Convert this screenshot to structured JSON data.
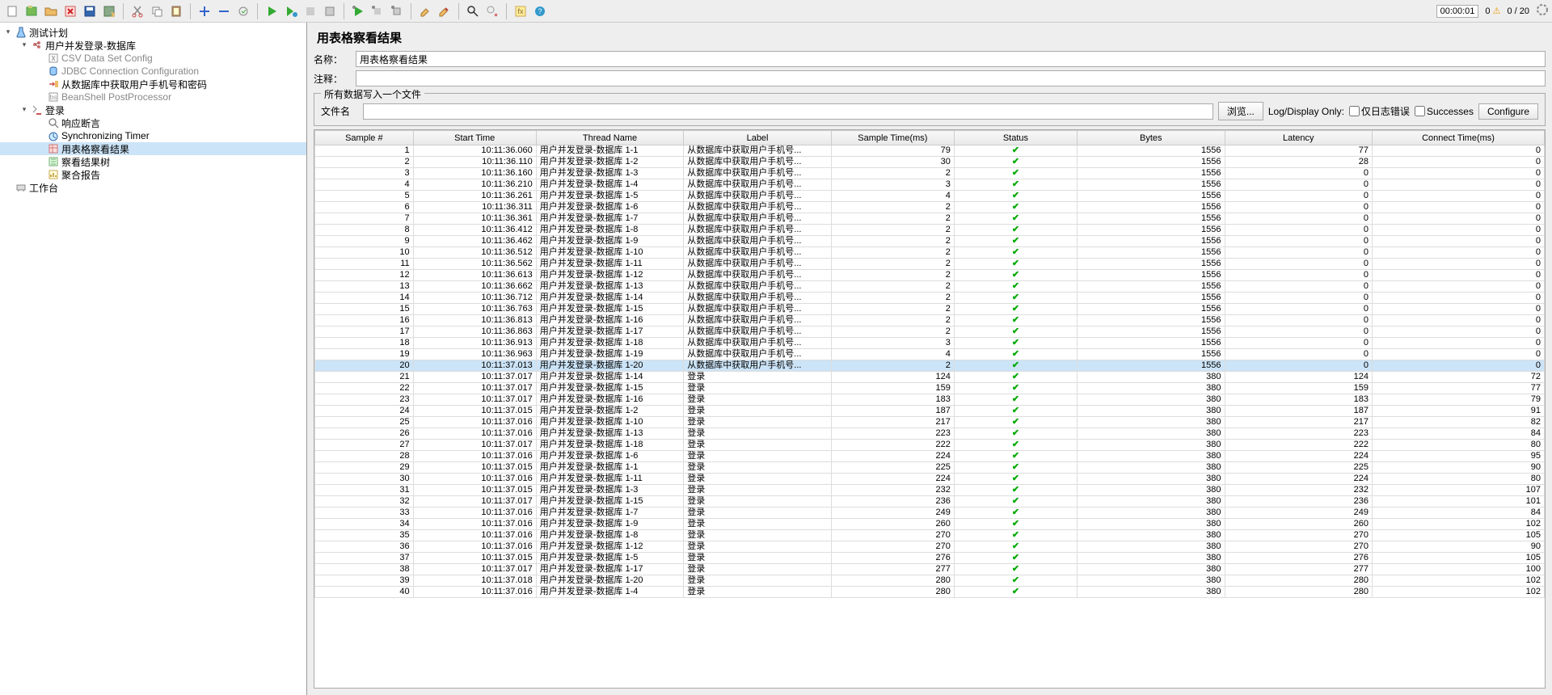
{
  "toolbar": {
    "right": {
      "timer": "00:00:01",
      "warn": "0",
      "threads": "0 / 20"
    }
  },
  "tree": [
    {
      "indent": 0,
      "exp": "▾",
      "icon": "flask",
      "label": "测试计划"
    },
    {
      "indent": 1,
      "exp": "▾",
      "icon": "threadgroup",
      "label": "用户并发登录-数据库"
    },
    {
      "indent": 2,
      "exp": "",
      "icon": "csv",
      "label": "CSV Data Set Config",
      "gray": true
    },
    {
      "indent": 2,
      "exp": "",
      "icon": "jdbc",
      "label": "JDBC Connection Configuration",
      "gray": true
    },
    {
      "indent": 2,
      "exp": "",
      "icon": "jdbcreq",
      "label": "从数据库中获取用户手机号和密码"
    },
    {
      "indent": 2,
      "exp": "",
      "icon": "beanshell",
      "label": "BeanShell PostProcessor",
      "gray": true
    },
    {
      "indent": 1,
      "exp": "▾",
      "icon": "http",
      "label": "登录"
    },
    {
      "indent": 2,
      "exp": "",
      "icon": "assertion",
      "label": "响应断言"
    },
    {
      "indent": 2,
      "exp": "",
      "icon": "timer",
      "label": "Synchronizing Timer"
    },
    {
      "indent": 2,
      "exp": "",
      "icon": "table",
      "label": "用表格察看结果",
      "selected": true
    },
    {
      "indent": 2,
      "exp": "",
      "icon": "tree",
      "label": "察看结果树"
    },
    {
      "indent": 2,
      "exp": "",
      "icon": "summary",
      "label": "聚合报告"
    },
    {
      "indent": 0,
      "exp": "",
      "icon": "workbench",
      "label": "工作台"
    }
  ],
  "panel": {
    "title": "用表格察看结果",
    "name_label": "名称：",
    "name_value": "用表格察看结果",
    "comment_label": "注释：",
    "group_title": "所有数据写入一个文件",
    "file_label": "文件名",
    "browse_btn": "浏览...",
    "log_display": "Log/Display Only:",
    "only_errors": "仅日志错误",
    "successes": "Successes",
    "configure": "Configure"
  },
  "table": {
    "headers": [
      "Sample #",
      "Start Time",
      "Thread Name",
      "Label",
      "Sample Time(ms)",
      "Status",
      "Bytes",
      "Latency",
      "Connect Time(ms)"
    ],
    "rows": [
      {
        "n": 1,
        "t": "10:11:36.060",
        "th": "用户并发登录-数据库 1-1",
        "lb": "从数据库中获取用户手机号...",
        "st": 79,
        "by": 1556,
        "la": 77,
        "ct": 0
      },
      {
        "n": 2,
        "t": "10:11:36.110",
        "th": "用户并发登录-数据库 1-2",
        "lb": "从数据库中获取用户手机号...",
        "st": 30,
        "by": 1556,
        "la": 28,
        "ct": 0
      },
      {
        "n": 3,
        "t": "10:11:36.160",
        "th": "用户并发登录-数据库 1-3",
        "lb": "从数据库中获取用户手机号...",
        "st": 2,
        "by": 1556,
        "la": 0,
        "ct": 0
      },
      {
        "n": 4,
        "t": "10:11:36.210",
        "th": "用户并发登录-数据库 1-4",
        "lb": "从数据库中获取用户手机号...",
        "st": 3,
        "by": 1556,
        "la": 0,
        "ct": 0
      },
      {
        "n": 5,
        "t": "10:11:36.261",
        "th": "用户并发登录-数据库 1-5",
        "lb": "从数据库中获取用户手机号...",
        "st": 4,
        "by": 1556,
        "la": 0,
        "ct": 0
      },
      {
        "n": 6,
        "t": "10:11:36.311",
        "th": "用户并发登录-数据库 1-6",
        "lb": "从数据库中获取用户手机号...",
        "st": 2,
        "by": 1556,
        "la": 0,
        "ct": 0
      },
      {
        "n": 7,
        "t": "10:11:36.361",
        "th": "用户并发登录-数据库 1-7",
        "lb": "从数据库中获取用户手机号...",
        "st": 2,
        "by": 1556,
        "la": 0,
        "ct": 0
      },
      {
        "n": 8,
        "t": "10:11:36.412",
        "th": "用户并发登录-数据库 1-8",
        "lb": "从数据库中获取用户手机号...",
        "st": 2,
        "by": 1556,
        "la": 0,
        "ct": 0
      },
      {
        "n": 9,
        "t": "10:11:36.462",
        "th": "用户并发登录-数据库 1-9",
        "lb": "从数据库中获取用户手机号...",
        "st": 2,
        "by": 1556,
        "la": 0,
        "ct": 0
      },
      {
        "n": 10,
        "t": "10:11:36.512",
        "th": "用户并发登录-数据库 1-10",
        "lb": "从数据库中获取用户手机号...",
        "st": 2,
        "by": 1556,
        "la": 0,
        "ct": 0
      },
      {
        "n": 11,
        "t": "10:11:36.562",
        "th": "用户并发登录-数据库 1-11",
        "lb": "从数据库中获取用户手机号...",
        "st": 2,
        "by": 1556,
        "la": 0,
        "ct": 0
      },
      {
        "n": 12,
        "t": "10:11:36.613",
        "th": "用户并发登录-数据库 1-12",
        "lb": "从数据库中获取用户手机号...",
        "st": 2,
        "by": 1556,
        "la": 0,
        "ct": 0
      },
      {
        "n": 13,
        "t": "10:11:36.662",
        "th": "用户并发登录-数据库 1-13",
        "lb": "从数据库中获取用户手机号...",
        "st": 2,
        "by": 1556,
        "la": 0,
        "ct": 0
      },
      {
        "n": 14,
        "t": "10:11:36.712",
        "th": "用户并发登录-数据库 1-14",
        "lb": "从数据库中获取用户手机号...",
        "st": 2,
        "by": 1556,
        "la": 0,
        "ct": 0
      },
      {
        "n": 15,
        "t": "10:11:36.763",
        "th": "用户并发登录-数据库 1-15",
        "lb": "从数据库中获取用户手机号...",
        "st": 2,
        "by": 1556,
        "la": 0,
        "ct": 0
      },
      {
        "n": 16,
        "t": "10:11:36.813",
        "th": "用户并发登录-数据库 1-16",
        "lb": "从数据库中获取用户手机号...",
        "st": 2,
        "by": 1556,
        "la": 0,
        "ct": 0
      },
      {
        "n": 17,
        "t": "10:11:36.863",
        "th": "用户并发登录-数据库 1-17",
        "lb": "从数据库中获取用户手机号...",
        "st": 2,
        "by": 1556,
        "la": 0,
        "ct": 0
      },
      {
        "n": 18,
        "t": "10:11:36.913",
        "th": "用户并发登录-数据库 1-18",
        "lb": "从数据库中获取用户手机号...",
        "st": 3,
        "by": 1556,
        "la": 0,
        "ct": 0
      },
      {
        "n": 19,
        "t": "10:11:36.963",
        "th": "用户并发登录-数据库 1-19",
        "lb": "从数据库中获取用户手机号...",
        "st": 4,
        "by": 1556,
        "la": 0,
        "ct": 0
      },
      {
        "n": 20,
        "t": "10:11:37.013",
        "th": "用户并发登录-数据库 1-20",
        "lb": "从数据库中获取用户手机号...",
        "st": 2,
        "by": 1556,
        "la": 0,
        "ct": 0,
        "sel": true
      },
      {
        "n": 21,
        "t": "10:11:37.017",
        "th": "用户并发登录-数据库 1-14",
        "lb": "登录",
        "st": 124,
        "by": 380,
        "la": 124,
        "ct": 72
      },
      {
        "n": 22,
        "t": "10:11:37.017",
        "th": "用户并发登录-数据库 1-15",
        "lb": "登录",
        "st": 159,
        "by": 380,
        "la": 159,
        "ct": 77
      },
      {
        "n": 23,
        "t": "10:11:37.017",
        "th": "用户并发登录-数据库 1-16",
        "lb": "登录",
        "st": 183,
        "by": 380,
        "la": 183,
        "ct": 79
      },
      {
        "n": 24,
        "t": "10:11:37.015",
        "th": "用户并发登录-数据库 1-2",
        "lb": "登录",
        "st": 187,
        "by": 380,
        "la": 187,
        "ct": 91
      },
      {
        "n": 25,
        "t": "10:11:37.016",
        "th": "用户并发登录-数据库 1-10",
        "lb": "登录",
        "st": 217,
        "by": 380,
        "la": 217,
        "ct": 82
      },
      {
        "n": 26,
        "t": "10:11:37.016",
        "th": "用户并发登录-数据库 1-13",
        "lb": "登录",
        "st": 223,
        "by": 380,
        "la": 223,
        "ct": 84
      },
      {
        "n": 27,
        "t": "10:11:37.017",
        "th": "用户并发登录-数据库 1-18",
        "lb": "登录",
        "st": 222,
        "by": 380,
        "la": 222,
        "ct": 80
      },
      {
        "n": 28,
        "t": "10:11:37.016",
        "th": "用户并发登录-数据库 1-6",
        "lb": "登录",
        "st": 224,
        "by": 380,
        "la": 224,
        "ct": 95
      },
      {
        "n": 29,
        "t": "10:11:37.015",
        "th": "用户并发登录-数据库 1-1",
        "lb": "登录",
        "st": 225,
        "by": 380,
        "la": 225,
        "ct": 90
      },
      {
        "n": 30,
        "t": "10:11:37.016",
        "th": "用户并发登录-数据库 1-11",
        "lb": "登录",
        "st": 224,
        "by": 380,
        "la": 224,
        "ct": 80
      },
      {
        "n": 31,
        "t": "10:11:37.015",
        "th": "用户并发登录-数据库 1-3",
        "lb": "登录",
        "st": 232,
        "by": 380,
        "la": 232,
        "ct": 107
      },
      {
        "n": 32,
        "t": "10:11:37.017",
        "th": "用户并发登录-数据库 1-15",
        "lb": "登录",
        "st": 236,
        "by": 380,
        "la": 236,
        "ct": 101
      },
      {
        "n": 33,
        "t": "10:11:37.016",
        "th": "用户并发登录-数据库 1-7",
        "lb": "登录",
        "st": 249,
        "by": 380,
        "la": 249,
        "ct": 84
      },
      {
        "n": 34,
        "t": "10:11:37.016",
        "th": "用户并发登录-数据库 1-9",
        "lb": "登录",
        "st": 260,
        "by": 380,
        "la": 260,
        "ct": 102
      },
      {
        "n": 35,
        "t": "10:11:37.016",
        "th": "用户并发登录-数据库 1-8",
        "lb": "登录",
        "st": 270,
        "by": 380,
        "la": 270,
        "ct": 105
      },
      {
        "n": 36,
        "t": "10:11:37.016",
        "th": "用户并发登录-数据库 1-12",
        "lb": "登录",
        "st": 270,
        "by": 380,
        "la": 270,
        "ct": 90
      },
      {
        "n": 37,
        "t": "10:11:37.015",
        "th": "用户并发登录-数据库 1-5",
        "lb": "登录",
        "st": 276,
        "by": 380,
        "la": 276,
        "ct": 105
      },
      {
        "n": 38,
        "t": "10:11:37.017",
        "th": "用户并发登录-数据库 1-17",
        "lb": "登录",
        "st": 277,
        "by": 380,
        "la": 277,
        "ct": 100
      },
      {
        "n": 39,
        "t": "10:11:37.018",
        "th": "用户并发登录-数据库 1-20",
        "lb": "登录",
        "st": 280,
        "by": 380,
        "la": 280,
        "ct": 102
      },
      {
        "n": 40,
        "t": "10:11:37.016",
        "th": "用户并发登录-数据库 1-4",
        "lb": "登录",
        "st": 280,
        "by": 380,
        "la": 280,
        "ct": 102
      }
    ]
  }
}
